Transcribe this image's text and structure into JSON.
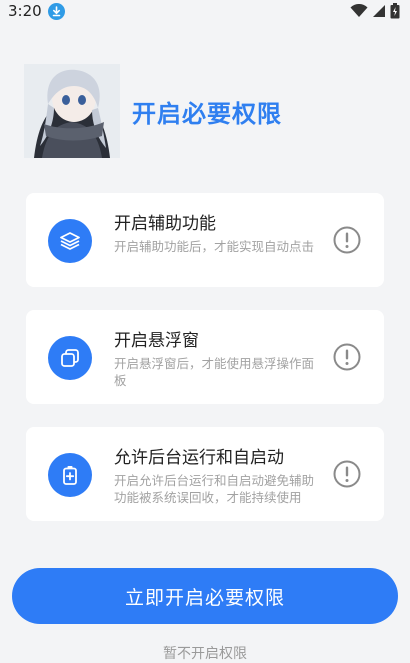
{
  "status_bar": {
    "time": "3:20"
  },
  "header": {
    "title": "开启必要权限"
  },
  "permissions": [
    {
      "title": "开启辅助功能",
      "description": "开启辅助功能后，才能实现自动点击"
    },
    {
      "title": "开启悬浮窗",
      "description": "开启悬浮窗后，才能使用悬浮操作面板"
    },
    {
      "title": "允许后台运行和自启动",
      "description": "开启允许后台运行和自启动避免辅助功能被系统误回收，才能持续使用"
    }
  ],
  "actions": {
    "primary_label": "立即开启必要权限",
    "secondary_label": "暂不开启权限"
  },
  "colors": {
    "accent": "#2e7cf6",
    "title": "#2f7ff0",
    "background": "#f3f4f6"
  }
}
